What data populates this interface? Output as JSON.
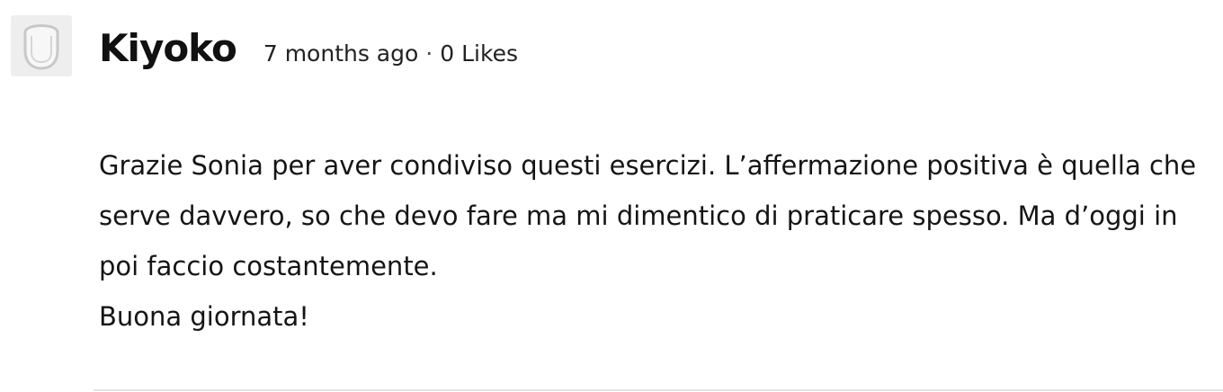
{
  "comment": {
    "author": "Kiyoko",
    "time_ago": "7 months ago",
    "separator": "·",
    "likes": "0 Likes",
    "avatar_icon": "default-user-avatar-icon",
    "text": "Grazie Sonia per aver condiviso questi esercizi. L’affermazione positiva è quella che serve davvero, so che devo fare ma mi dimentico di praticare spesso. Ma d’oggi in poi faccio costantemente.\nBuona giornata!"
  },
  "colors": {
    "avatar_bg": "#eeeeee",
    "avatar_stroke": "#c8c8c8",
    "divider": "#e3e3e3",
    "text": "#151515"
  }
}
